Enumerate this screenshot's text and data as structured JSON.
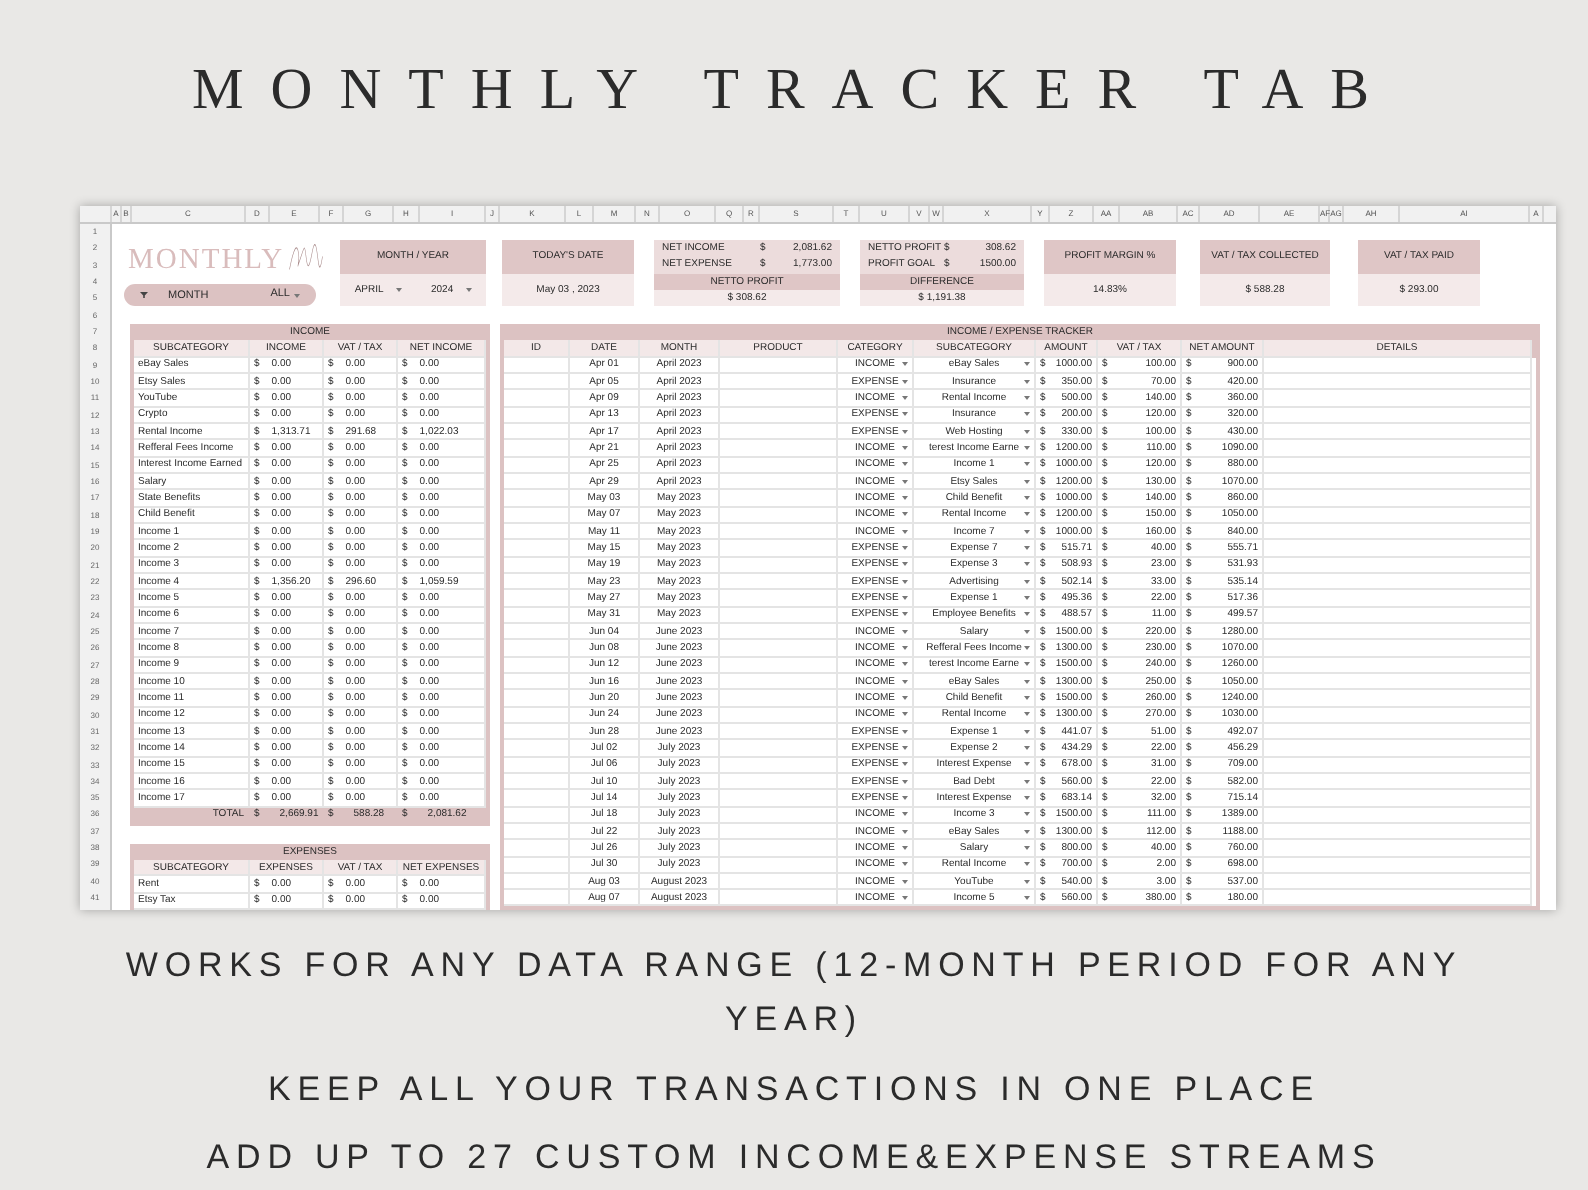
{
  "page_title": "MONTHLY TRACKER TAB",
  "sheet": {
    "column_letters": [
      "A",
      "B",
      "C",
      "D",
      "E",
      "F",
      "G",
      "H",
      "I",
      "J",
      "K",
      "L",
      "M",
      "N",
      "O",
      "Q",
      "R",
      "S",
      "T",
      "U",
      "V",
      "W",
      "X",
      "Y",
      "Z",
      "AA",
      "AB",
      "AC",
      "AD",
      "AE",
      "AF",
      "AG",
      "AH",
      "AI",
      "A"
    ],
    "row_numbers": [
      "1",
      "2",
      "3",
      "4",
      "5",
      "6",
      "7",
      "8",
      "9",
      "10",
      "11",
      "12",
      "13",
      "14",
      "15",
      "16",
      "17",
      "18",
      "19",
      "20",
      "21",
      "22",
      "23",
      "24",
      "25",
      "26",
      "27",
      "28",
      "29",
      "30",
      "31",
      "32",
      "33",
      "34",
      "35",
      "36",
      "37",
      "38",
      "39",
      "40",
      "41"
    ],
    "logo": {
      "text": "MONTHLY"
    },
    "filter": {
      "label": "MONTH",
      "value": "ALL"
    },
    "month_year": {
      "title": "MONTH / YEAR",
      "month": "APRIL",
      "year": "2024"
    },
    "todays_date": {
      "title": "TODAY'S DATE",
      "value": "May 03 , 2023"
    },
    "net_summary": {
      "lines": [
        {
          "label": "NET INCOME",
          "value": "$ 2,081.62"
        },
        {
          "label": "NET EXPENSE",
          "value": "$ 1,773.00"
        }
      ],
      "subtitle": "NETTO PROFIT",
      "total": "$ 308.62"
    },
    "profit_goal": {
      "lines": [
        {
          "label": "NETTO PROFIT",
          "value": "$ 308.62"
        },
        {
          "label": "PROFIT GOAL",
          "value": "$ 1500.00"
        }
      ],
      "subtitle": "DIFFERENCE",
      "total": "$ 1,191.38"
    },
    "kpis": [
      {
        "title": "PROFIT MARGIN %",
        "value": "14.83%"
      },
      {
        "title": "VAT / TAX COLLECTED",
        "value": "$ 588.28"
      },
      {
        "title": "VAT / TAX PAID",
        "value": "$ 293.00"
      }
    ],
    "income": {
      "title": "INCOME",
      "columns": [
        "SUBCATEGORY",
        "INCOME",
        "VAT / TAX",
        "NET INCOME"
      ],
      "rows": [
        [
          "eBay Sales",
          "$ 0.00",
          "$ 0.00",
          "$ 0.00"
        ],
        [
          "Etsy Sales",
          "$ 0.00",
          "$ 0.00",
          "$ 0.00"
        ],
        [
          "YouTube",
          "$ 0.00",
          "$ 0.00",
          "$ 0.00"
        ],
        [
          "Crypto",
          "$ 0.00",
          "$ 0.00",
          "$ 0.00"
        ],
        [
          "Rental Income",
          "$ 1,313.71",
          "$ 291.68",
          "$ 1,022.03"
        ],
        [
          "Refferal Fees Income",
          "$ 0.00",
          "$ 0.00",
          "$ 0.00"
        ],
        [
          "Interest Income Earned",
          "$ 0.00",
          "$ 0.00",
          "$ 0.00"
        ],
        [
          "Salary",
          "$ 0.00",
          "$ 0.00",
          "$ 0.00"
        ],
        [
          "State Benefits",
          "$ 0.00",
          "$ 0.00",
          "$ 0.00"
        ],
        [
          "Child Benefit",
          "$ 0.00",
          "$ 0.00",
          "$ 0.00"
        ],
        [
          "Income 1",
          "$ 0.00",
          "$ 0.00",
          "$ 0.00"
        ],
        [
          "Income 2",
          "$ 0.00",
          "$ 0.00",
          "$ 0.00"
        ],
        [
          "Income 3",
          "$ 0.00",
          "$ 0.00",
          "$ 0.00"
        ],
        [
          "Income 4",
          "$ 1,356.20",
          "$ 296.60",
          "$ 1,059.59"
        ],
        [
          "Income 5",
          "$ 0.00",
          "$ 0.00",
          "$ 0.00"
        ],
        [
          "Income 6",
          "$ 0.00",
          "$ 0.00",
          "$ 0.00"
        ],
        [
          "Income 7",
          "$ 0.00",
          "$ 0.00",
          "$ 0.00"
        ],
        [
          "Income 8",
          "$ 0.00",
          "$ 0.00",
          "$ 0.00"
        ],
        [
          "Income 9",
          "$ 0.00",
          "$ 0.00",
          "$ 0.00"
        ],
        [
          "Income 10",
          "$ 0.00",
          "$ 0.00",
          "$ 0.00"
        ],
        [
          "Income 11",
          "$ 0.00",
          "$ 0.00",
          "$ 0.00"
        ],
        [
          "Income 12",
          "$ 0.00",
          "$ 0.00",
          "$ 0.00"
        ],
        [
          "Income 13",
          "$ 0.00",
          "$ 0.00",
          "$ 0.00"
        ],
        [
          "Income 14",
          "$ 0.00",
          "$ 0.00",
          "$ 0.00"
        ],
        [
          "Income 15",
          "$ 0.00",
          "$ 0.00",
          "$ 0.00"
        ],
        [
          "Income 16",
          "$ 0.00",
          "$ 0.00",
          "$ 0.00"
        ],
        [
          "Income 17",
          "$ 0.00",
          "$ 0.00",
          "$ 0.00"
        ]
      ],
      "total": [
        "TOTAL",
        "$ 2,669.91",
        "$ 588.28",
        "$ 2,081.62"
      ]
    },
    "expenses": {
      "title": "EXPENSES",
      "columns": [
        "SUBCATEGORY",
        "EXPENSES",
        "VAT / TAX",
        "NET EXPENSES"
      ],
      "rows": [
        [
          "Rent",
          "$ 0.00",
          "$ 0.00",
          "$ 0.00"
        ],
        [
          "Etsy Tax",
          "$ 0.00",
          "$ 0.00",
          "$ 0.00"
        ]
      ]
    },
    "tracker": {
      "title": "INCOME / EXPENSE TRACKER",
      "columns": [
        "ID",
        "DATE",
        "MONTH",
        "PRODUCT",
        "CATEGORY",
        "SUBCATEGORY",
        "AMOUNT",
        "VAT / TAX",
        "NET AMOUNT",
        "DETAILS"
      ],
      "rows": [
        [
          "",
          "Apr 01",
          "April 2023",
          "",
          "INCOME",
          "eBay Sales",
          "$ 1000.00",
          "$ 100.00",
          "$ 900.00",
          ""
        ],
        [
          "",
          "Apr 05",
          "April 2023",
          "",
          "EXPENSE",
          "Insurance",
          "$ 350.00",
          "$ 70.00",
          "$ 420.00",
          ""
        ],
        [
          "",
          "Apr 09",
          "April 2023",
          "",
          "INCOME",
          "Rental Income",
          "$ 500.00",
          "$ 140.00",
          "$ 360.00",
          ""
        ],
        [
          "",
          "Apr 13",
          "April 2023",
          "",
          "EXPENSE",
          "Insurance",
          "$ 200.00",
          "$ 120.00",
          "$ 320.00",
          ""
        ],
        [
          "",
          "Apr 17",
          "April 2023",
          "",
          "EXPENSE",
          "Web Hosting",
          "$ 330.00",
          "$ 100.00",
          "$ 430.00",
          ""
        ],
        [
          "",
          "Apr 21",
          "April 2023",
          "",
          "INCOME",
          "terest Income Earne",
          "$ 1200.00",
          "$ 110.00",
          "$ 1090.00",
          ""
        ],
        [
          "",
          "Apr 25",
          "April 2023",
          "",
          "INCOME",
          "Income 1",
          "$ 1000.00",
          "$ 120.00",
          "$ 880.00",
          ""
        ],
        [
          "",
          "Apr 29",
          "April 2023",
          "",
          "INCOME",
          "Etsy Sales",
          "$ 1200.00",
          "$ 130.00",
          "$ 1070.00",
          ""
        ],
        [
          "",
          "May 03",
          "May 2023",
          "",
          "INCOME",
          "Child Benefit",
          "$ 1000.00",
          "$ 140.00",
          "$ 860.00",
          ""
        ],
        [
          "",
          "May 07",
          "May 2023",
          "",
          "INCOME",
          "Rental Income",
          "$ 1200.00",
          "$ 150.00",
          "$ 1050.00",
          ""
        ],
        [
          "",
          "May 11",
          "May 2023",
          "",
          "INCOME",
          "Income 7",
          "$ 1000.00",
          "$ 160.00",
          "$ 840.00",
          ""
        ],
        [
          "",
          "May 15",
          "May 2023",
          "",
          "EXPENSE",
          "Expense 7",
          "$ 515.71",
          "$ 40.00",
          "$ 555.71",
          ""
        ],
        [
          "",
          "May 19",
          "May 2023",
          "",
          "EXPENSE",
          "Expense 3",
          "$ 508.93",
          "$ 23.00",
          "$ 531.93",
          ""
        ],
        [
          "",
          "May 23",
          "May 2023",
          "",
          "EXPENSE",
          "Advertising",
          "$ 502.14",
          "$ 33.00",
          "$ 535.14",
          ""
        ],
        [
          "",
          "May 27",
          "May 2023",
          "",
          "EXPENSE",
          "Expense 1",
          "$ 495.36",
          "$ 22.00",
          "$ 517.36",
          ""
        ],
        [
          "",
          "May 31",
          "May 2023",
          "",
          "EXPENSE",
          "Employee Benefits",
          "$ 488.57",
          "$ 11.00",
          "$ 499.57",
          ""
        ],
        [
          "",
          "Jun 04",
          "June 2023",
          "",
          "INCOME",
          "Salary",
          "$ 1500.00",
          "$ 220.00",
          "$ 1280.00",
          ""
        ],
        [
          "",
          "Jun 08",
          "June 2023",
          "",
          "INCOME",
          "Refferal Fees Income",
          "$ 1300.00",
          "$ 230.00",
          "$ 1070.00",
          ""
        ],
        [
          "",
          "Jun 12",
          "June 2023",
          "",
          "INCOME",
          "terest Income Earne",
          "$ 1500.00",
          "$ 240.00",
          "$ 1260.00",
          ""
        ],
        [
          "",
          "Jun 16",
          "June 2023",
          "",
          "INCOME",
          "eBay Sales",
          "$ 1300.00",
          "$ 250.00",
          "$ 1050.00",
          ""
        ],
        [
          "",
          "Jun 20",
          "June 2023",
          "",
          "INCOME",
          "Child Benefit",
          "$ 1500.00",
          "$ 260.00",
          "$ 1240.00",
          ""
        ],
        [
          "",
          "Jun 24",
          "June 2023",
          "",
          "INCOME",
          "Rental Income",
          "$ 1300.00",
          "$ 270.00",
          "$ 1030.00",
          ""
        ],
        [
          "",
          "Jun 28",
          "June 2023",
          "",
          "EXPENSE",
          "Expense 1",
          "$ 441.07",
          "$ 51.00",
          "$ 492.07",
          ""
        ],
        [
          "",
          "Jul 02",
          "July 2023",
          "",
          "EXPENSE",
          "Expense 2",
          "$ 434.29",
          "$ 22.00",
          "$ 456.29",
          ""
        ],
        [
          "",
          "Jul 06",
          "July 2023",
          "",
          "EXPENSE",
          "Interest Expense",
          "$ 678.00",
          "$ 31.00",
          "$ 709.00",
          ""
        ],
        [
          "",
          "Jul 10",
          "July 2023",
          "",
          "EXPENSE",
          "Bad Debt",
          "$ 560.00",
          "$ 22.00",
          "$ 582.00",
          ""
        ],
        [
          "",
          "Jul 14",
          "July 2023",
          "",
          "EXPENSE",
          "Interest Expense",
          "$ 683.14",
          "$ 32.00",
          "$ 715.14",
          ""
        ],
        [
          "",
          "Jul 18",
          "July 2023",
          "",
          "INCOME",
          "Income 3",
          "$ 1500.00",
          "$ 111.00",
          "$ 1389.00",
          ""
        ],
        [
          "",
          "Jul 22",
          "July 2023",
          "",
          "INCOME",
          "eBay Sales",
          "$ 1300.00",
          "$ 112.00",
          "$ 1188.00",
          ""
        ],
        [
          "",
          "Jul 26",
          "July 2023",
          "",
          "INCOME",
          "Salary",
          "$ 800.00",
          "$ 40.00",
          "$ 760.00",
          ""
        ],
        [
          "",
          "Jul 30",
          "July 2023",
          "",
          "INCOME",
          "Rental Income",
          "$ 700.00",
          "$ 2.00",
          "$ 698.00",
          ""
        ],
        [
          "",
          "Aug 03",
          "August 2023",
          "",
          "INCOME",
          "YouTube",
          "$ 540.00",
          "$ 3.00",
          "$ 537.00",
          ""
        ],
        [
          "",
          "Aug 07",
          "August 2023",
          "",
          "INCOME",
          "Income 5",
          "$ 560.00",
          "$ 380.00",
          "$ 180.00",
          ""
        ]
      ]
    }
  },
  "captions": [
    "WORKS FOR ANY DATA RANGE (12-MONTH PERIOD FOR ANY YEAR)",
    "KEEP ALL YOUR TRANSACTIONS IN ONE PLACE",
    "ADD UP TO 27 CUSTOM INCOME&EXPENSE STREAMS"
  ]
}
